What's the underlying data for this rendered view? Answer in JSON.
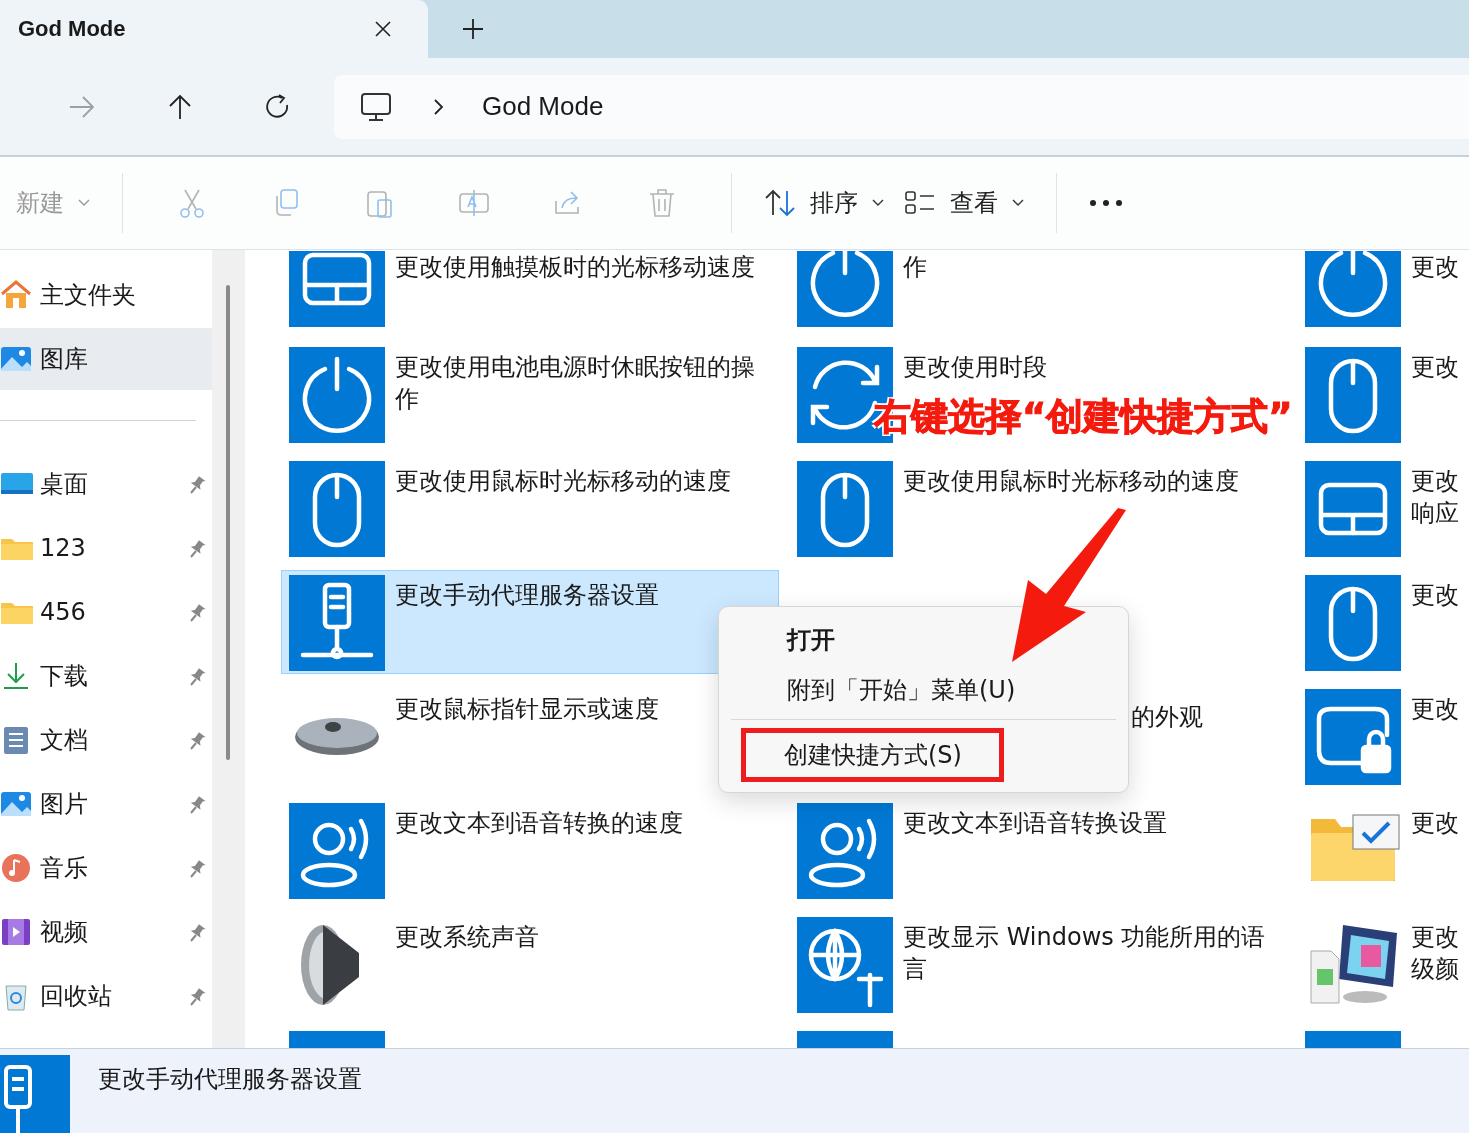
{
  "tabs": [
    {
      "title": "God Mode",
      "selected": true
    }
  ],
  "nav": [
    {
      "kind": "forward",
      "disabled": true
    },
    {
      "kind": "up",
      "disabled": false
    },
    {
      "kind": "refresh",
      "disabled": false
    }
  ],
  "address": {
    "path": [
      "God Mode"
    ]
  },
  "toolbar": {
    "new": {
      "label": "新建",
      "disabled": true
    },
    "actions": [
      {
        "kind": "cut",
        "disabled": true
      },
      {
        "kind": "copy",
        "disabled": true
      },
      {
        "kind": "paste",
        "disabled": true
      },
      {
        "kind": "rename",
        "disabled": true
      },
      {
        "kind": "share",
        "disabled": true
      },
      {
        "kind": "delete",
        "disabled": true
      }
    ],
    "sort": {
      "label": "排序"
    },
    "view": {
      "label": "查看"
    }
  },
  "sidebar": {
    "items": [
      {
        "label": "主文件夹",
        "kind": "home",
        "selected": false,
        "pinned": false
      },
      {
        "label": "图库",
        "kind": "gallery",
        "selected": true,
        "pinned": false
      },
      {
        "label": "桌面",
        "kind": "desktop",
        "selected": false,
        "pinned": true
      },
      {
        "label": "123",
        "kind": "folder",
        "selected": false,
        "pinned": true
      },
      {
        "label": "456",
        "kind": "folder",
        "selected": false,
        "pinned": true
      },
      {
        "label": "下载",
        "kind": "download",
        "selected": false,
        "pinned": true
      },
      {
        "label": "文档",
        "kind": "document",
        "selected": false,
        "pinned": true
      },
      {
        "label": "图片",
        "kind": "picture",
        "selected": false,
        "pinned": true
      },
      {
        "label": "音乐",
        "kind": "music",
        "selected": false,
        "pinned": true
      },
      {
        "label": "视频",
        "kind": "video",
        "selected": false,
        "pinned": true
      },
      {
        "label": "回收站",
        "kind": "recycle",
        "selected": false,
        "pinned": true
      }
    ]
  },
  "items": [
    {
      "kind": "touchpad",
      "lines": [
        "更改使用触摸板时的光标移动速度"
      ],
      "selected": false
    },
    {
      "kind": "power",
      "lines": [
        "作"
      ],
      "selected": false
    },
    {
      "kind": "power",
      "lines": [
        "更改"
      ],
      "selected": false
    },
    {
      "kind": "power",
      "lines": [
        "更改使用电池电源时休眠按钮的操",
        "作"
      ],
      "selected": false
    },
    {
      "kind": "sync",
      "lines": [
        "更改使用时段"
      ],
      "selected": false
    },
    {
      "kind": "mouse",
      "lines": [
        "更改"
      ],
      "selected": false
    },
    {
      "kind": "mouse",
      "lines": [
        "更改使用鼠标时光标移动的速度"
      ],
      "selected": false
    },
    {
      "kind": "mouse",
      "lines": [
        "更改使用鼠标时光标移动的速度"
      ],
      "selected": false
    },
    {
      "kind": "touchpad",
      "lines": [
        "更改",
        "响应"
      ],
      "selected": false
    },
    {
      "kind": "proxy",
      "lines": [
        "更改手动代理服务器设置"
      ],
      "selected": true
    },
    {
      "kind": "none"
    },
    {
      "kind": "mouse",
      "lines": [
        "更改"
      ],
      "selected": false
    },
    {
      "kind": "mouse-photo",
      "lines": [
        "更改鼠标指针显示或速度"
      ],
      "selected": false
    },
    {
      "kind": "none",
      "lines": [
        "的外观"
      ],
      "covered": true,
      "selected": false
    },
    {
      "kind": "lock",
      "lines": [
        "更改"
      ],
      "selected": false
    },
    {
      "kind": "speech",
      "lines": [
        "更改文本到语音转换的速度"
      ],
      "selected": false
    },
    {
      "kind": "speech",
      "lines": [
        "更改文本到语音转换设置"
      ],
      "selected": false
    },
    {
      "kind": "folder-check",
      "lines": [
        "更改"
      ],
      "selected": false
    },
    {
      "kind": "speaker",
      "lines": [
        "更改系统声音"
      ],
      "selected": false
    },
    {
      "kind": "globe",
      "lines": [
        "更改显示 Windows 功能所用的语",
        "言"
      ],
      "selected": false
    },
    {
      "kind": "color-monitor",
      "lines": [
        "更改",
        "级颜"
      ],
      "selected": false
    },
    {
      "kind": "blank",
      "selected": false
    },
    {
      "kind": "blank",
      "selected": false
    },
    {
      "kind": "blank",
      "selected": false
    }
  ],
  "context_menu": {
    "items": [
      {
        "label": "打开",
        "bold": true,
        "separator_before": false,
        "highlighted": false
      },
      {
        "label": "附到「开始」菜单(U)",
        "bold": false,
        "separator_before": false,
        "highlighted": false
      },
      {
        "label": "创建快捷方式(S)",
        "bold": false,
        "separator_before": true,
        "highlighted": true
      }
    ]
  },
  "annotation": {
    "text": "右键选择“创建快捷方式”"
  },
  "status_bar": {
    "text": "更改手动代理服务器设置"
  }
}
